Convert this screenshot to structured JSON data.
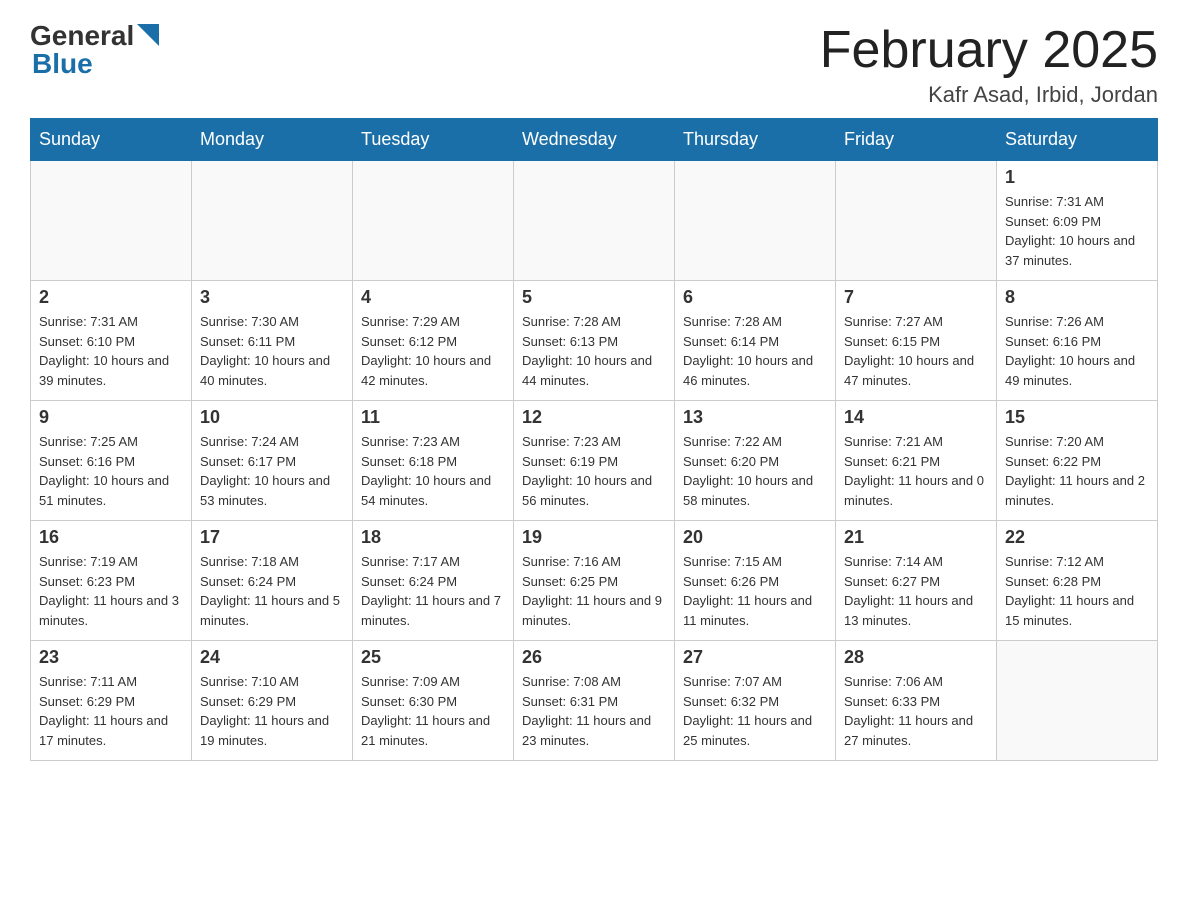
{
  "header": {
    "logo_general": "General",
    "logo_blue": "Blue",
    "month_title": "February 2025",
    "location": "Kafr Asad, Irbid, Jordan"
  },
  "days_of_week": [
    "Sunday",
    "Monday",
    "Tuesday",
    "Wednesday",
    "Thursday",
    "Friday",
    "Saturday"
  ],
  "weeks": [
    [
      {
        "day": "",
        "info": ""
      },
      {
        "day": "",
        "info": ""
      },
      {
        "day": "",
        "info": ""
      },
      {
        "day": "",
        "info": ""
      },
      {
        "day": "",
        "info": ""
      },
      {
        "day": "",
        "info": ""
      },
      {
        "day": "1",
        "info": "Sunrise: 7:31 AM\nSunset: 6:09 PM\nDaylight: 10 hours and 37 minutes."
      }
    ],
    [
      {
        "day": "2",
        "info": "Sunrise: 7:31 AM\nSunset: 6:10 PM\nDaylight: 10 hours and 39 minutes."
      },
      {
        "day": "3",
        "info": "Sunrise: 7:30 AM\nSunset: 6:11 PM\nDaylight: 10 hours and 40 minutes."
      },
      {
        "day": "4",
        "info": "Sunrise: 7:29 AM\nSunset: 6:12 PM\nDaylight: 10 hours and 42 minutes."
      },
      {
        "day": "5",
        "info": "Sunrise: 7:28 AM\nSunset: 6:13 PM\nDaylight: 10 hours and 44 minutes."
      },
      {
        "day": "6",
        "info": "Sunrise: 7:28 AM\nSunset: 6:14 PM\nDaylight: 10 hours and 46 minutes."
      },
      {
        "day": "7",
        "info": "Sunrise: 7:27 AM\nSunset: 6:15 PM\nDaylight: 10 hours and 47 minutes."
      },
      {
        "day": "8",
        "info": "Sunrise: 7:26 AM\nSunset: 6:16 PM\nDaylight: 10 hours and 49 minutes."
      }
    ],
    [
      {
        "day": "9",
        "info": "Sunrise: 7:25 AM\nSunset: 6:16 PM\nDaylight: 10 hours and 51 minutes."
      },
      {
        "day": "10",
        "info": "Sunrise: 7:24 AM\nSunset: 6:17 PM\nDaylight: 10 hours and 53 minutes."
      },
      {
        "day": "11",
        "info": "Sunrise: 7:23 AM\nSunset: 6:18 PM\nDaylight: 10 hours and 54 minutes."
      },
      {
        "day": "12",
        "info": "Sunrise: 7:23 AM\nSunset: 6:19 PM\nDaylight: 10 hours and 56 minutes."
      },
      {
        "day": "13",
        "info": "Sunrise: 7:22 AM\nSunset: 6:20 PM\nDaylight: 10 hours and 58 minutes."
      },
      {
        "day": "14",
        "info": "Sunrise: 7:21 AM\nSunset: 6:21 PM\nDaylight: 11 hours and 0 minutes."
      },
      {
        "day": "15",
        "info": "Sunrise: 7:20 AM\nSunset: 6:22 PM\nDaylight: 11 hours and 2 minutes."
      }
    ],
    [
      {
        "day": "16",
        "info": "Sunrise: 7:19 AM\nSunset: 6:23 PM\nDaylight: 11 hours and 3 minutes."
      },
      {
        "day": "17",
        "info": "Sunrise: 7:18 AM\nSunset: 6:24 PM\nDaylight: 11 hours and 5 minutes."
      },
      {
        "day": "18",
        "info": "Sunrise: 7:17 AM\nSunset: 6:24 PM\nDaylight: 11 hours and 7 minutes."
      },
      {
        "day": "19",
        "info": "Sunrise: 7:16 AM\nSunset: 6:25 PM\nDaylight: 11 hours and 9 minutes."
      },
      {
        "day": "20",
        "info": "Sunrise: 7:15 AM\nSunset: 6:26 PM\nDaylight: 11 hours and 11 minutes."
      },
      {
        "day": "21",
        "info": "Sunrise: 7:14 AM\nSunset: 6:27 PM\nDaylight: 11 hours and 13 minutes."
      },
      {
        "day": "22",
        "info": "Sunrise: 7:12 AM\nSunset: 6:28 PM\nDaylight: 11 hours and 15 minutes."
      }
    ],
    [
      {
        "day": "23",
        "info": "Sunrise: 7:11 AM\nSunset: 6:29 PM\nDaylight: 11 hours and 17 minutes."
      },
      {
        "day": "24",
        "info": "Sunrise: 7:10 AM\nSunset: 6:29 PM\nDaylight: 11 hours and 19 minutes."
      },
      {
        "day": "25",
        "info": "Sunrise: 7:09 AM\nSunset: 6:30 PM\nDaylight: 11 hours and 21 minutes."
      },
      {
        "day": "26",
        "info": "Sunrise: 7:08 AM\nSunset: 6:31 PM\nDaylight: 11 hours and 23 minutes."
      },
      {
        "day": "27",
        "info": "Sunrise: 7:07 AM\nSunset: 6:32 PM\nDaylight: 11 hours and 25 minutes."
      },
      {
        "day": "28",
        "info": "Sunrise: 7:06 AM\nSunset: 6:33 PM\nDaylight: 11 hours and 27 minutes."
      },
      {
        "day": "",
        "info": ""
      }
    ]
  ]
}
